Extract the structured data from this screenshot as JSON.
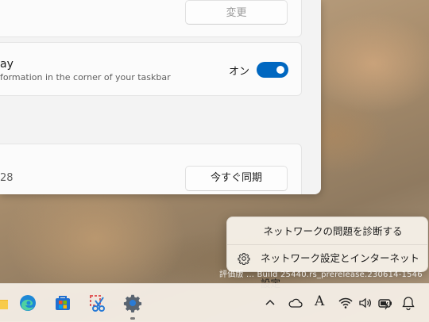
{
  "settings": {
    "change_button": "変更",
    "toggle_title": "ay",
    "toggle_desc": "formation in the corner of your taskbar",
    "toggle_state": "オン",
    "sync_value": "28",
    "sync_button": "今すぐ同期"
  },
  "context_menu": {
    "items": [
      "ネットワークの問題を診断する",
      "ネットワーク設定とインターネット設定"
    ]
  },
  "watermark": "評価版 ...  Build 25440.rs_prerelease.230614-1546",
  "taskbar": {
    "apps": [
      "folder-icon",
      "edge-icon",
      "store-icon",
      "snipping-tool-icon",
      "settings-icon"
    ],
    "tray": [
      "chevron-up-icon",
      "cloud-icon",
      "ime-indicator",
      "wifi-icon",
      "volume-icon",
      "battery-icon",
      "notification-icon"
    ],
    "ime_char": "A"
  }
}
